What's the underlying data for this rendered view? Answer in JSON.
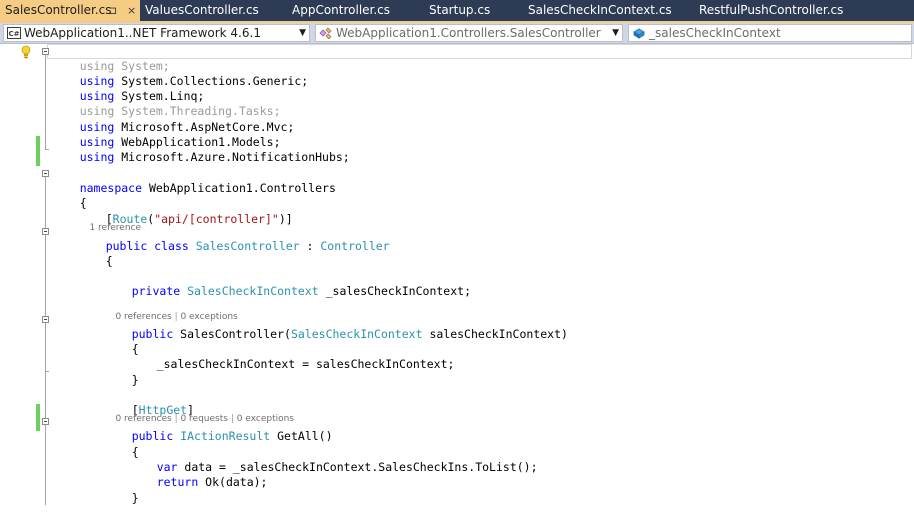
{
  "tabs": [
    {
      "label": "SalesController.cs",
      "pin": "⊐",
      "close": "×"
    },
    {
      "label": "ValuesController.cs"
    },
    {
      "label": "AppController.cs"
    },
    {
      "label": "Startup.cs"
    },
    {
      "label": "SalesCheckInContext.cs"
    },
    {
      "label": "RestfulPushController.cs"
    }
  ],
  "navbar": {
    "project": "WebApplication1..NET Framework 4.6.1",
    "type_scope": "WebApplication1.Controllers.SalesController",
    "member": "_salesCheckInContext"
  },
  "code": {
    "l1_kw": "using",
    "l1_rest": " System;",
    "l2_kw": "using",
    "l2_rest": " System.Collections.Generic;",
    "l3_kw": "using",
    "l3_rest": " System.Linq;",
    "l4_kw": "using",
    "l4_rest": " System.Threading.Tasks;",
    "l5_kw": "using",
    "l5_rest": " Microsoft.AspNetCore.Mvc;",
    "l6_kw": "using",
    "l6_rest": " WebApplication1.Models;",
    "l7_kw": "using",
    "l7_rest": " Microsoft.Azure.NotificationHubs;",
    "ns_kw": "namespace",
    "ns_name": " WebApplication1.Controllers",
    "brace_open": "{",
    "brace_close": "}",
    "attr_open": "[",
    "attr_name": "Route",
    "attr_paren": "(",
    "attr_str": "\"api/[controller]\"",
    "attr_close": ")]",
    "class_mods": "public class",
    "class_name": "SalesController",
    "class_colon": " : ",
    "class_base": "Controller",
    "field_kw": "private",
    "field_type": "SalesCheckInContext",
    "field_rest": " _salesCheckInContext;",
    "ctor_kw": "public",
    "ctor_name": " SalesController(",
    "ctor_type": "SalesCheckInContext",
    "ctor_rest": " salesCheckInContext)",
    "assign": "_salesCheckInContext = salesCheckInContext;",
    "httpget_open": "[",
    "httpget_name": "HttpGet",
    "httpget_close": "]",
    "get_kw": "public",
    "get_type": "IActionResult",
    "get_rest": " GetAll()",
    "var_kw": "var",
    "var_rest": " data = _salesCheckInContext.SalesCheckIns.ToList();",
    "ret_kw": "return",
    "ret_rest": " Ok(data);"
  },
  "codelens": {
    "class_refs": "1 reference",
    "ctor_refs": "0 references",
    "ctor_sep": " | ",
    "ctor_exc": "0 exceptions",
    "get_refs": "0 references",
    "get_sep1": " | ",
    "get_reqs": "0 requests",
    "get_sep2": " | ",
    "get_exc": "0 exceptions"
  },
  "colors": {
    "tab_strip": "#2d3b54",
    "active_tab": "#f5cc84",
    "keyword": "#0000ff",
    "type": "#2b91af",
    "string": "#a31515",
    "change_bar": "#6cd05d"
  },
  "icons": {
    "project": "csharp-project-icon",
    "type_scope": "class-icon",
    "member": "field-icon",
    "lightbulb": "lightbulb-icon"
  }
}
